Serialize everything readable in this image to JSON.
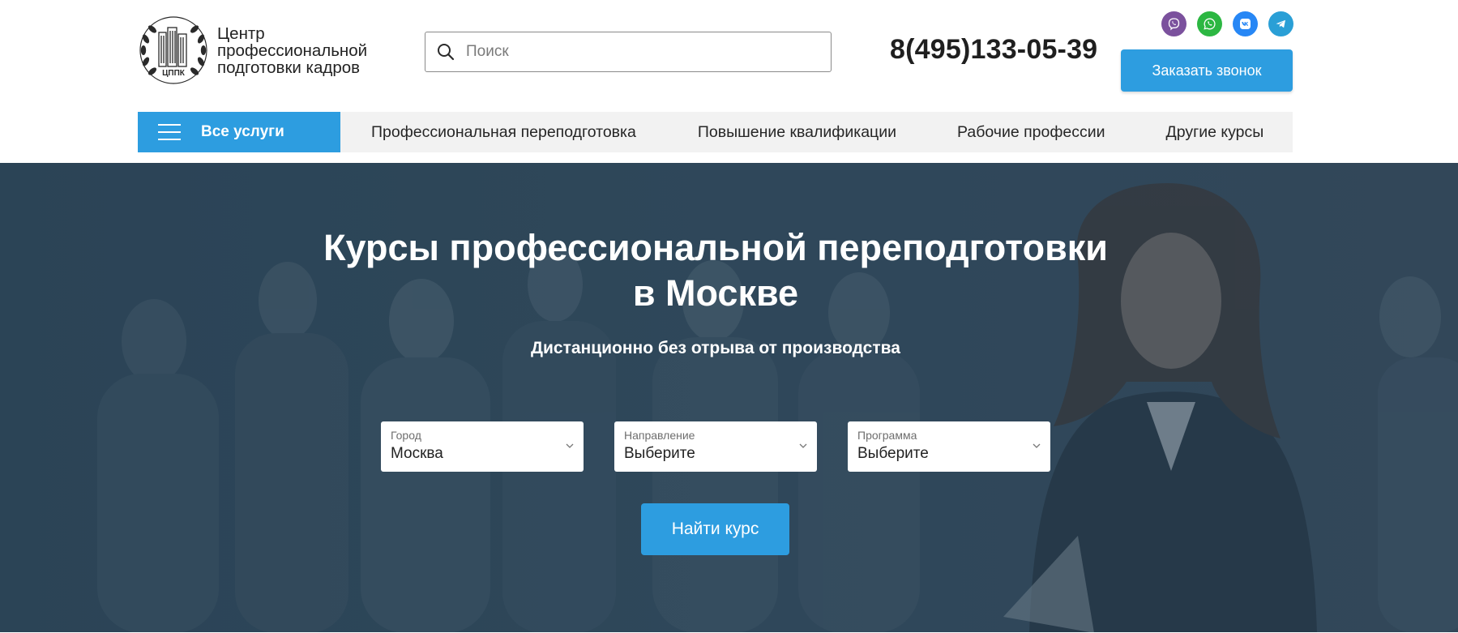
{
  "header": {
    "logo": {
      "emblem_text": "ЦППК",
      "lines": [
        "Центр",
        "профессиональной",
        "подготовки кадров"
      ]
    },
    "search": {
      "placeholder": "Поиск",
      "value": ""
    },
    "phone": "8(495)133-05-39",
    "socials": [
      {
        "name": "viber",
        "icon": "viber-icon",
        "color": "#7b519d"
      },
      {
        "name": "whatsapp",
        "icon": "whatsapp-icon",
        "color": "#2cb742"
      },
      {
        "name": "vk",
        "icon": "vk-icon",
        "color": "#2787f5"
      },
      {
        "name": "telegram",
        "icon": "telegram-icon",
        "color": "#2a9fd6"
      }
    ],
    "callback_label": "Заказать звонок"
  },
  "nav": {
    "all_services": "Все услуги",
    "links": [
      "Профессиональная переподготовка",
      "Повышение квалификации",
      "Рабочие профессии",
      "Другие курсы"
    ]
  },
  "hero": {
    "title_line1": "Курсы профессиональной переподготовки",
    "title_line2": "в Москве",
    "subtitle": "Дистанционно без отрыва от производства",
    "selects": [
      {
        "label": "Город",
        "value": "Москва"
      },
      {
        "label": "Направление",
        "value": "Выберите"
      },
      {
        "label": "Программа",
        "value": "Выберите"
      }
    ],
    "find_label": "Найти курс"
  },
  "colors": {
    "accent": "#2d9de0",
    "hero_overlay": "#2b4456",
    "nav_bg": "#f2f2f2"
  }
}
